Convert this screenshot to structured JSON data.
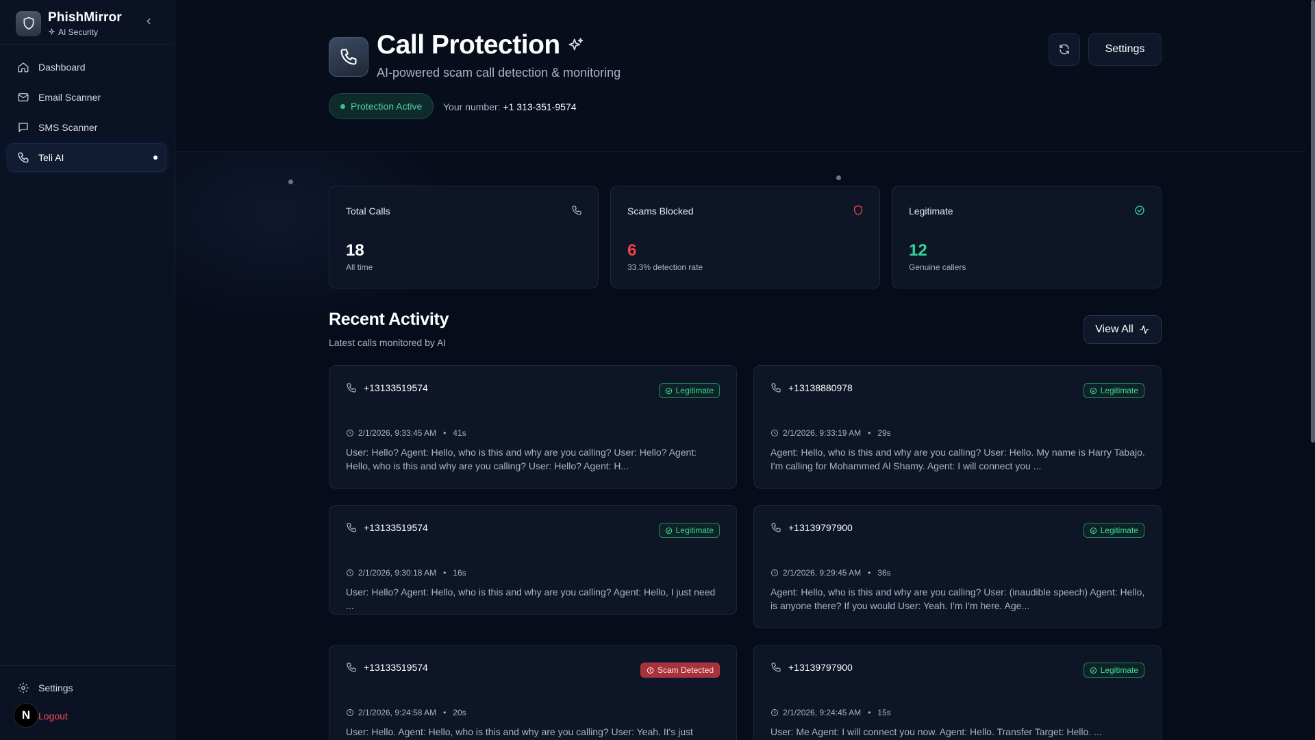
{
  "brand": {
    "name": "PhishMirror",
    "tagline": "AI Security"
  },
  "sidebar": {
    "items": [
      {
        "label": "Dashboard",
        "icon": "home-icon"
      },
      {
        "label": "Email Scanner",
        "icon": "mail-icon"
      },
      {
        "label": "SMS Scanner",
        "icon": "message-icon"
      },
      {
        "label": "Teli AI",
        "icon": "phone-icon",
        "active": true
      }
    ],
    "settings_label": "Settings",
    "logout_label": "Logout",
    "avatar_letter": "N"
  },
  "header": {
    "title": "Call Protection",
    "subtitle": "AI-powered scam call detection & monitoring",
    "status": "Protection Active",
    "number_label": "Your number:",
    "number_value": "+1 313-351-9574",
    "settings_button": "Settings"
  },
  "stats": [
    {
      "label": "Total Calls",
      "value": "18",
      "sub": "All time",
      "icon": "phone-icon",
      "color": "#ffffff"
    },
    {
      "label": "Scams Blocked",
      "value": "6",
      "sub": "33.3% detection rate",
      "icon": "shield-icon",
      "color": "#ef4444"
    },
    {
      "label": "Legitimate",
      "value": "12",
      "sub": "Genuine callers",
      "icon": "check-circle-icon",
      "color": "#34d399"
    }
  ],
  "recent": {
    "title": "Recent Activity",
    "subtitle": "Latest calls monitored by AI",
    "view_all": "View All",
    "calls": [
      {
        "number": "+13133519574",
        "badge": "Legitimate",
        "kind": "legit",
        "time": "2/1/2026, 9:33:45 AM",
        "duration": "41s",
        "text": "User: Hello? Agent: Hello, who is this and why are you calling? User: Hello? Agent: Hello, who is this and why are you calling? User: Hello? Agent: H..."
      },
      {
        "number": "+13138880978",
        "badge": "Legitimate",
        "kind": "legit",
        "time": "2/1/2026, 9:33:19 AM",
        "duration": "29s",
        "text": "Agent: Hello, who is this and why are you calling? User: Hello. My name is Harry Tabajo. I'm calling for Mohammed Al Shamy. Agent: I will connect you ..."
      },
      {
        "number": "+13133519574",
        "badge": "Legitimate",
        "kind": "legit",
        "time": "2/1/2026, 9:30:18 AM",
        "duration": "16s",
        "text": "User: Hello? Agent: Hello, who is this and why are you calling? Agent: Hello, I just need ..."
      },
      {
        "number": "+13139797900",
        "badge": "Legitimate",
        "kind": "legit",
        "time": "2/1/2026, 9:29:45 AM",
        "duration": "36s",
        "text": "Agent: Hello, who is this and why are you calling? User: (inaudible speech) Agent: Hello, is anyone there? If you would User: Yeah. I'm I'm here. Age..."
      },
      {
        "number": "+13133519574",
        "badge": "Scam Detected",
        "kind": "scam",
        "time": "2/1/2026, 9:24:58 AM",
        "duration": "20s",
        "text": "User: Hello. Agent: Hello, who is this and why are you calling? User: Yeah. It's just gonna"
      },
      {
        "number": "+13139797900",
        "badge": "Legitimate",
        "kind": "legit",
        "time": "2/1/2026, 9:24:45 AM",
        "duration": "15s",
        "text": "User: Me Agent: I will connect you now. Agent: Hello. Transfer Target: Hello. ..."
      }
    ]
  }
}
